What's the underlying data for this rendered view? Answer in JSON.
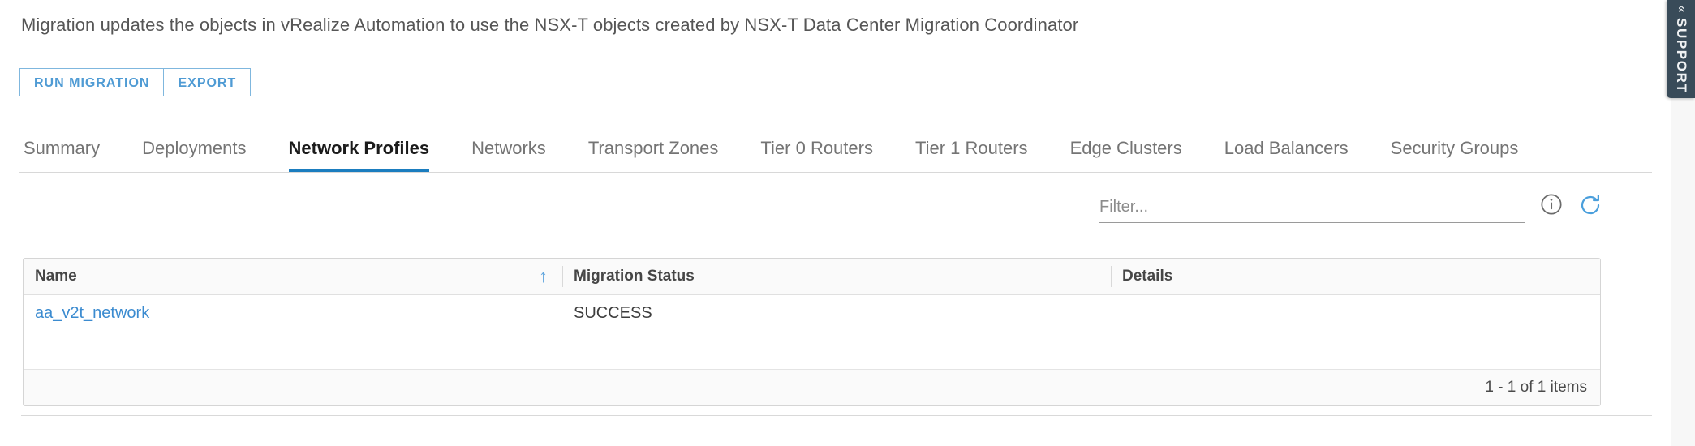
{
  "page": {
    "description": "Migration updates the objects in vRealize Automation to use the NSX-T objects created by NSX-T Data Center Migration Coordinator"
  },
  "actions": {
    "run_migration_label": "RUN MIGRATION",
    "export_label": "EXPORT"
  },
  "tabs": [
    {
      "label": "Summary",
      "active": false
    },
    {
      "label": "Deployments",
      "active": false
    },
    {
      "label": "Network Profiles",
      "active": true
    },
    {
      "label": "Networks",
      "active": false
    },
    {
      "label": "Transport Zones",
      "active": false
    },
    {
      "label": "Tier 0 Routers",
      "active": false
    },
    {
      "label": "Tier 1 Routers",
      "active": false
    },
    {
      "label": "Edge Clusters",
      "active": false
    },
    {
      "label": "Load Balancers",
      "active": false
    },
    {
      "label": "Security Groups",
      "active": false
    }
  ],
  "toolbar": {
    "filter_placeholder": "Filter...",
    "filter_value": "",
    "info_icon": "info-circle-icon",
    "refresh_icon": "refresh-icon"
  },
  "table": {
    "columns": [
      {
        "label": "Name",
        "sort": "asc"
      },
      {
        "label": "Migration Status",
        "sort": ""
      },
      {
        "label": "Details",
        "sort": ""
      }
    ],
    "sort_arrow_glyph": "↑",
    "rows": [
      {
        "name": "aa_v2t_network",
        "status": "SUCCESS",
        "details": ""
      },
      {
        "name": "",
        "status": "",
        "details": ""
      }
    ],
    "footer_text": "1 - 1 of 1 items"
  },
  "support": {
    "label": "SUPPORT",
    "chevron_glyph": "«"
  },
  "colors": {
    "accent_blue": "#1b7dbf",
    "link_blue": "#3b8bd0",
    "button_blue": "#4f9bd4",
    "support_dark": "#394b59",
    "text_grey": "#565656"
  }
}
